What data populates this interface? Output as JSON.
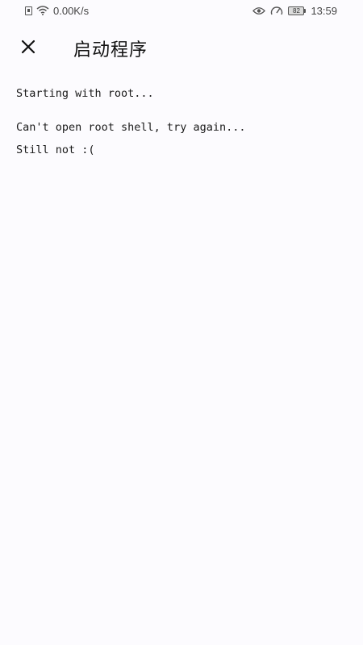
{
  "status_bar": {
    "network_speed": "0.00K/s",
    "battery_level": "82",
    "time": "13:59",
    "icons": [
      "sim-icon",
      "wifi-icon",
      "eye-icon",
      "speed-icon",
      "battery-icon"
    ]
  },
  "app_bar": {
    "title": "启动程序",
    "close_icon": "close-icon"
  },
  "console": {
    "lines": [
      "Starting with root...",
      "Can't open root shell, try again...",
      "Still not :("
    ]
  }
}
